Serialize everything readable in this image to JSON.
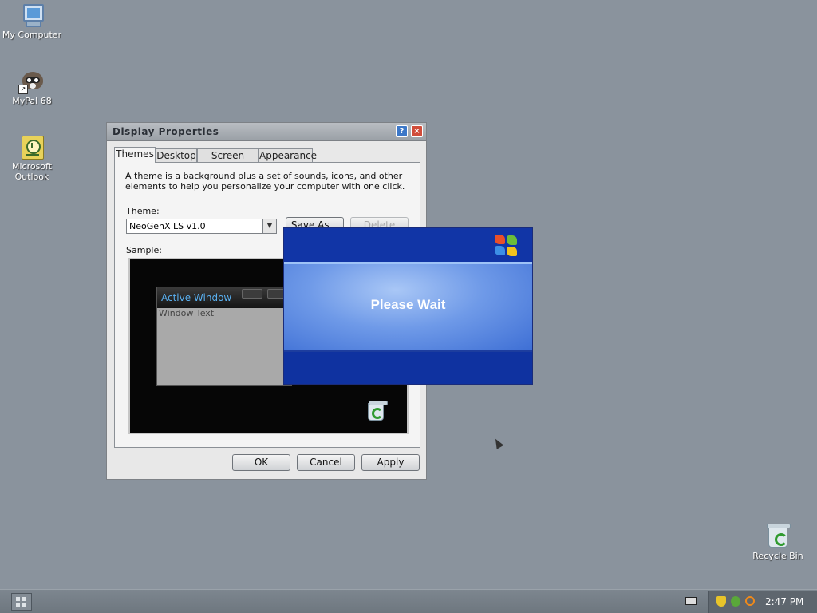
{
  "desktop": {
    "icons": [
      {
        "label": "My Computer"
      },
      {
        "label": "MyPal 68"
      },
      {
        "label": "Microsoft Outlook"
      },
      {
        "label": "Recycle Bin"
      }
    ],
    "background_color": "#8a939d"
  },
  "display_properties": {
    "title": "Display Properties",
    "tabs": [
      {
        "label": "Themes",
        "active": true
      },
      {
        "label": "Desktop"
      },
      {
        "label": "Screen Saver"
      },
      {
        "label": "Appearance"
      }
    ],
    "description": "A theme is a background plus a set of sounds, icons, and other elements to help you personalize your computer with one click.",
    "theme_label": "Theme:",
    "theme_value": "NeoGenX LS v1.0",
    "save_as_label": "Save As...",
    "delete_label": "Delete",
    "sample_label": "Sample:",
    "sample": {
      "active_window_title": "Active Window",
      "window_text": "Window Text"
    },
    "ok_label": "OK",
    "cancel_label": "Cancel",
    "apply_label": "Apply"
  },
  "please_wait": {
    "text": "Please Wait"
  },
  "taskbar": {
    "clock": "2:47 PM"
  }
}
